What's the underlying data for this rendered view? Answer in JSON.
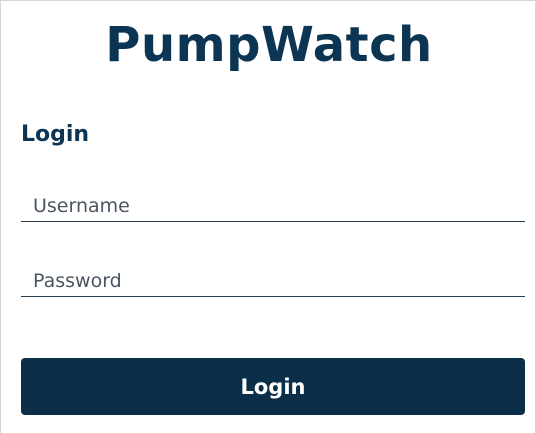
{
  "app": {
    "brand": "PumpWatch"
  },
  "login": {
    "heading": "Login",
    "username_placeholder": "Username",
    "password_placeholder": "Password",
    "submit_label": "Login"
  },
  "colors": {
    "brand": "#0b3552",
    "button_bg": "#0b2f49",
    "button_text": "#ffffff",
    "field_underline": "#2a3f52"
  }
}
